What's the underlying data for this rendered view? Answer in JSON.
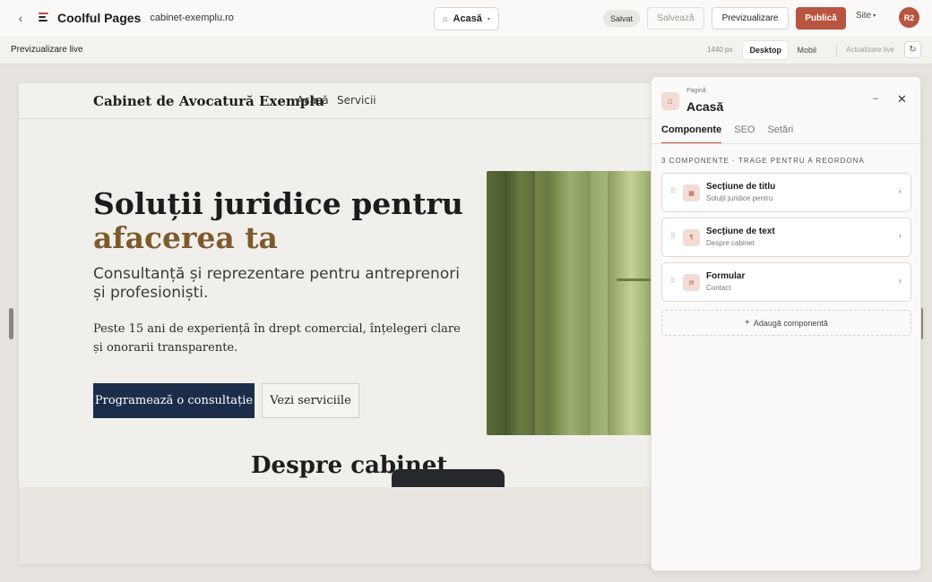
{
  "topbar": {
    "back_icon": "‹",
    "brand": "Coolful Pages",
    "domain": "cabinet-exemplu.ro",
    "page_select": {
      "icon": "⌂",
      "label": "Acasă",
      "caret": "▾"
    },
    "saved_chip": "Salvat",
    "save_label": "Salvează",
    "preview_label": "Previzualizare",
    "publish_label": "Publică",
    "site_menu": "Site",
    "site_caret": "▾",
    "avatar": "R2"
  },
  "subbar": {
    "live_label": "Previzualizare live",
    "width_label": "1440 px",
    "devices": {
      "desktop": "Desktop",
      "mobile": "Mobil"
    },
    "live_update": "Actualizare live",
    "refresh_icon": "↻"
  },
  "site": {
    "name": "Cabinet de Avocatură Exemplu",
    "nav": [
      "Acasă",
      "Servicii"
    ],
    "hero": {
      "title_line1": "Soluții juridice pentru",
      "title_line2": "afacerea ta",
      "subtitle": "Consultanță și reprezentare pentru antreprenori și profesioniști.",
      "body": "Peste 15 ani de experiență în drept comercial, înțelegeri clare și onorarii transparente.",
      "cta_primary": "Programează o consultație",
      "cta_secondary": "Vezi serviciile"
    },
    "about_title": "Despre cabinet"
  },
  "panel": {
    "icon": "⌂",
    "kicker": "Pagină",
    "title": "Acasă",
    "minimize_icon": "–",
    "close_icon": "✕",
    "tabs": [
      "Componente",
      "SEO",
      "Setări"
    ],
    "count_label": "3 componente · trage pentru a reordona",
    "components": [
      {
        "grip": "⠿",
        "icon": "▦",
        "name": "Secțiune de titlu",
        "desc": "Soluții juridice pentru",
        "chev": "›"
      },
      {
        "grip": "⠿",
        "icon": "¶",
        "name": "Secțiune de text",
        "desc": "Despre cabinet",
        "chev": "›"
      },
      {
        "grip": "⠿",
        "icon": "✉",
        "name": "Formular",
        "desc": "Contact",
        "chev": "›"
      }
    ],
    "add_icon": "+",
    "add_label": "Adaugă componentă"
  },
  "colors": {
    "accent": "#b8543f",
    "navy": "#1c2d4a",
    "gold": "#7d5a2c"
  }
}
